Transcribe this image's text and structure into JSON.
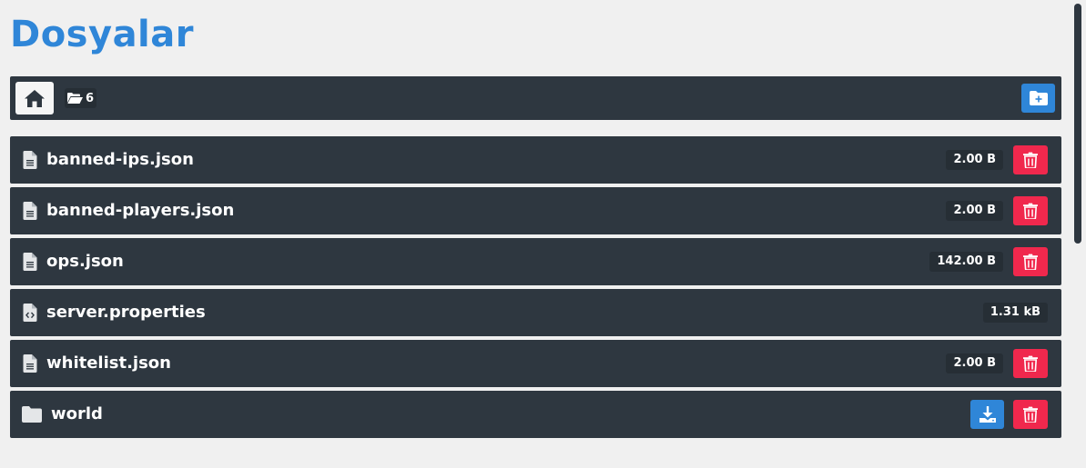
{
  "header": {
    "title": "Dosyalar"
  },
  "toolbar": {
    "home_icon": "home-icon",
    "folder_count_icon": "folder-open-icon",
    "folder_count": "6",
    "new_folder_icon": "folder-plus-icon"
  },
  "files": [
    {
      "name": "banned-ips.json",
      "type": "file",
      "icon": "file-text-icon",
      "size": "2.00 B",
      "deletable": true,
      "downloadable": false
    },
    {
      "name": "banned-players.json",
      "type": "file",
      "icon": "file-text-icon",
      "size": "2.00 B",
      "deletable": true,
      "downloadable": false
    },
    {
      "name": "ops.json",
      "type": "file",
      "icon": "file-text-icon",
      "size": "142.00 B",
      "deletable": true,
      "downloadable": false
    },
    {
      "name": "server.properties",
      "type": "file",
      "icon": "file-code-icon",
      "size": "1.31 kB",
      "deletable": false,
      "downloadable": false
    },
    {
      "name": "whitelist.json",
      "type": "file",
      "icon": "file-text-icon",
      "size": "2.00 B",
      "deletable": true,
      "downloadable": false
    },
    {
      "name": "world",
      "type": "folder",
      "icon": "folder-icon",
      "size": "",
      "deletable": true,
      "downloadable": true
    }
  ],
  "colors": {
    "accent": "#2f86d8",
    "row_background": "#2e3740",
    "danger": "#f0284d",
    "page_background": "#f0f0f0"
  }
}
